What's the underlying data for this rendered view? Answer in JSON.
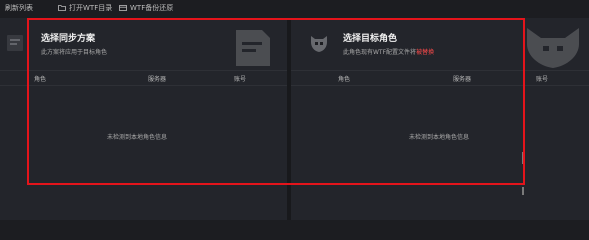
{
  "toolbar": {
    "refresh_label": "刷新列表",
    "open_wtf_label": "打开WTF目录",
    "wtf_backup_label": "WTF备份还原"
  },
  "left_panel": {
    "title": "选择同步方案",
    "subtitle": "此方案将应用于目标角色",
    "columns": [
      "角色",
      "服务器",
      "账号"
    ],
    "empty_text": "未检测到本地角色信息"
  },
  "right_panel": {
    "title": "选择目标角色",
    "subtitle_prefix": "此角色现有WTF配置文件将",
    "subtitle_warning": "被替换",
    "columns": [
      "角色",
      "服务器",
      "账号"
    ],
    "empty_text": "未检测到本地角色信息"
  },
  "colors": {
    "background": "#1c1d21",
    "panel": "#23252b",
    "warning": "#ff4b4b",
    "highlight": "#e4141b"
  },
  "icons": {
    "left_header": "document-icon",
    "right_header": "helmet-icon"
  }
}
